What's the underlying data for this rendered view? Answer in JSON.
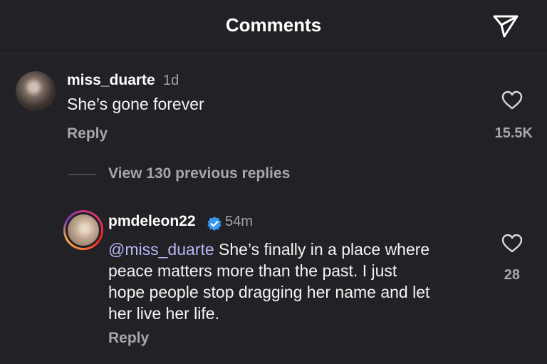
{
  "header": {
    "title": "Comments",
    "share_icon": "send-icon"
  },
  "comments": [
    {
      "username": "miss_duarte",
      "time": "1d",
      "text": "She’s gone forever",
      "reply_label": "Reply",
      "likes": "15.5K"
    }
  ],
  "view_replies_label": "View 130 previous replies",
  "reply": {
    "username": "pmdeleon22",
    "verified": true,
    "time": "54m",
    "mention": "@miss_duarte",
    "text_lines": [
      " She’s finally in a place where",
      "peace matters more than the past. I just",
      "hope people stop dragging her name and let",
      "her live her life."
    ],
    "reply_label": "Reply",
    "likes": "28"
  },
  "colors": {
    "background": "#222226",
    "verified": "#3897f0",
    "mention": "#b8b6f5"
  }
}
